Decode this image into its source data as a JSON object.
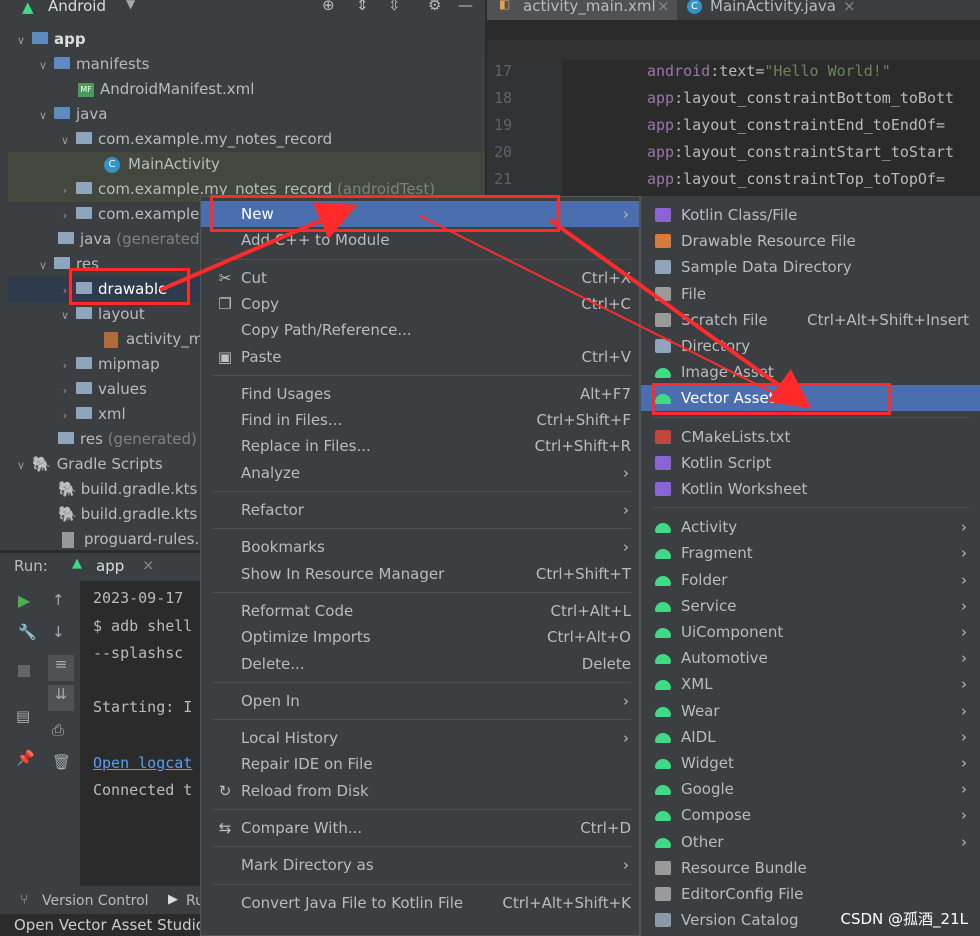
{
  "top_bar": {
    "project_view": "Android"
  },
  "editor_tabs": [
    {
      "label": "activity_main.xml"
    },
    {
      "label": "MainActivity.java"
    }
  ],
  "project_tree": [
    {
      "label": "app",
      "indent": 0
    },
    {
      "label": "manifests",
      "indent": 1
    },
    {
      "label": "AndroidManifest.xml",
      "indent": 2
    },
    {
      "label": "java",
      "indent": 1
    },
    {
      "label": "com.example.my_notes_record",
      "indent": 2
    },
    {
      "label": "MainActivity",
      "indent": 3
    },
    {
      "label": "com.example.my_notes_record",
      "suffix": "(androidTest)",
      "indent": 2
    },
    {
      "label": "com.example",
      "indent": 2
    },
    {
      "label": "java",
      "suffix": "(generated)",
      "indent": 1
    },
    {
      "label": "res",
      "indent": 1
    },
    {
      "label": "drawable",
      "indent": 2
    },
    {
      "label": "layout",
      "indent": 2
    },
    {
      "label": "activity_m",
      "indent": 3
    },
    {
      "label": "mipmap",
      "indent": 2
    },
    {
      "label": "values",
      "indent": 2
    },
    {
      "label": "xml",
      "indent": 2
    },
    {
      "label": "res",
      "suffix": "(generated)",
      "indent": 1
    },
    {
      "label": "Gradle Scripts",
      "indent": 0
    },
    {
      "label": "build.gradle.kts",
      "indent": 1
    },
    {
      "label": "build.gradle.kts",
      "indent": 1
    },
    {
      "label": "proguard-rules.",
      "indent": 1
    }
  ],
  "code": {
    "line_numbers": [
      "17",
      "18",
      "19",
      "20",
      "21"
    ],
    "lines": [
      {
        "prefix": "android",
        "attr": ":text=",
        "value": "\"Hello World!\""
      },
      {
        "prefix": "app",
        "attr": ":layout_constraintBottom_toBott",
        "value": ""
      },
      {
        "prefix": "app",
        "attr": ":layout_constraintEnd_toEndOf=",
        "value": ""
      },
      {
        "prefix": "app",
        "attr": ":layout_constraintStart_toStart",
        "value": ""
      },
      {
        "prefix": "app",
        "attr": ":layout_constraintTop_toTopOf=",
        "value": ""
      }
    ]
  },
  "run_panel": {
    "label": "Run:",
    "config": "app",
    "console": [
      "2023-09-17",
      "$ adb shell",
      "  --splashsc",
      "",
      "Starting: I",
      "",
      "Open logcat",
      "Connected t"
    ]
  },
  "status_bar": {
    "version_control": "Version Control",
    "run_tab": "Ru",
    "message": "Open Vector Asset Studio"
  },
  "context_menu": [
    {
      "label": "New",
      "shortcut": "",
      "submenu": true,
      "icon": "",
      "highlight": true
    },
    {
      "label": "Add C++ to Module",
      "shortcut": "",
      "icon": ""
    },
    {
      "sep": true
    },
    {
      "label": "Cut",
      "shortcut": "Ctrl+X",
      "icon": "scissors-icon"
    },
    {
      "label": "Copy",
      "shortcut": "Ctrl+C",
      "icon": "copy-icon"
    },
    {
      "label": "Copy Path/Reference...",
      "shortcut": "",
      "icon": ""
    },
    {
      "label": "Paste",
      "shortcut": "Ctrl+V",
      "icon": "paste-icon"
    },
    {
      "sep": true
    },
    {
      "label": "Find Usages",
      "shortcut": "Alt+F7",
      "icon": ""
    },
    {
      "label": "Find in Files...",
      "shortcut": "Ctrl+Shift+F",
      "icon": ""
    },
    {
      "label": "Replace in Files...",
      "shortcut": "Ctrl+Shift+R",
      "icon": ""
    },
    {
      "label": "Analyze",
      "shortcut": "",
      "submenu": true,
      "icon": ""
    },
    {
      "sep": true
    },
    {
      "label": "Refactor",
      "shortcut": "",
      "submenu": true,
      "icon": ""
    },
    {
      "sep": true
    },
    {
      "label": "Bookmarks",
      "shortcut": "",
      "submenu": true,
      "icon": ""
    },
    {
      "label": "Show In Resource Manager",
      "shortcut": "Ctrl+Shift+T",
      "icon": ""
    },
    {
      "sep": true
    },
    {
      "label": "Reformat Code",
      "shortcut": "Ctrl+Alt+L",
      "icon": ""
    },
    {
      "label": "Optimize Imports",
      "shortcut": "Ctrl+Alt+O",
      "icon": ""
    },
    {
      "label": "Delete...",
      "shortcut": "Delete",
      "icon": ""
    },
    {
      "sep": true
    },
    {
      "label": "Open In",
      "shortcut": "",
      "submenu": true,
      "icon": ""
    },
    {
      "sep": true
    },
    {
      "label": "Local History",
      "shortcut": "",
      "submenu": true,
      "icon": ""
    },
    {
      "label": "Repair IDE on File",
      "shortcut": "",
      "icon": ""
    },
    {
      "label": "Reload from Disk",
      "shortcut": "",
      "icon": "reload-icon"
    },
    {
      "sep": true
    },
    {
      "label": "Compare With...",
      "shortcut": "Ctrl+D",
      "icon": "compare-icon"
    },
    {
      "sep": true
    },
    {
      "label": "Mark Directory as",
      "shortcut": "",
      "submenu": true,
      "icon": ""
    },
    {
      "sep": true
    },
    {
      "label": "Convert Java File to Kotlin File",
      "shortcut": "Ctrl+Alt+Shift+K",
      "icon": ""
    }
  ],
  "new_submenu": [
    {
      "label": "Kotlin Class/File",
      "shortcut": "",
      "icon": "kotlin-icon"
    },
    {
      "label": "Drawable Resource File",
      "shortcut": "",
      "icon": "drawable-icon"
    },
    {
      "label": "Sample Data Directory",
      "shortcut": "",
      "icon": "folder-icon"
    },
    {
      "label": "File",
      "shortcut": "",
      "icon": "file-icon"
    },
    {
      "label": "Scratch File",
      "shortcut": "Ctrl+Alt+Shift+Insert",
      "icon": "scratch-icon"
    },
    {
      "label": "Directory",
      "shortcut": "",
      "icon": "folder-icon"
    },
    {
      "label": "Image Asset",
      "shortcut": "",
      "icon": "android-icon"
    },
    {
      "label": "Vector Asset",
      "shortcut": "",
      "icon": "android-icon",
      "highlight": true
    },
    {
      "sep": true
    },
    {
      "label": "CMakeLists.txt",
      "shortcut": "",
      "icon": "cmake-icon"
    },
    {
      "label": "Kotlin Script",
      "shortcut": "",
      "icon": "kotlin-icon"
    },
    {
      "label": "Kotlin Worksheet",
      "shortcut": "",
      "icon": "kotlin-icon"
    },
    {
      "sep": true
    },
    {
      "label": "Activity",
      "submenu": true,
      "icon": "android-icon"
    },
    {
      "label": "Fragment",
      "submenu": true,
      "icon": "android-icon"
    },
    {
      "label": "Folder",
      "submenu": true,
      "icon": "android-icon"
    },
    {
      "label": "Service",
      "submenu": true,
      "icon": "android-icon"
    },
    {
      "label": "UiComponent",
      "submenu": true,
      "icon": "android-icon"
    },
    {
      "label": "Automotive",
      "submenu": true,
      "icon": "android-icon"
    },
    {
      "label": "XML",
      "submenu": true,
      "icon": "android-icon"
    },
    {
      "label": "Wear",
      "submenu": true,
      "icon": "android-icon"
    },
    {
      "label": "AIDL",
      "submenu": true,
      "icon": "android-icon"
    },
    {
      "label": "Widget",
      "submenu": true,
      "icon": "android-icon"
    },
    {
      "label": "Google",
      "submenu": true,
      "icon": "android-icon"
    },
    {
      "label": "Compose",
      "submenu": true,
      "icon": "android-icon"
    },
    {
      "label": "Other",
      "submenu": true,
      "icon": "android-icon"
    },
    {
      "label": "Resource Bundle",
      "shortcut": "",
      "icon": "bundle-icon"
    },
    {
      "label": "EditorConfig File",
      "shortcut": "",
      "icon": "gear-icon"
    },
    {
      "label": "Version Catalog",
      "shortcut": "",
      "icon": "elephant-icon"
    }
  ],
  "watermark": "CSDN @孤酒_21L",
  "colors": {
    "highlight": "#4b6eaf",
    "annotation": "#ff2a2a",
    "android_green": "#3ddc84"
  }
}
